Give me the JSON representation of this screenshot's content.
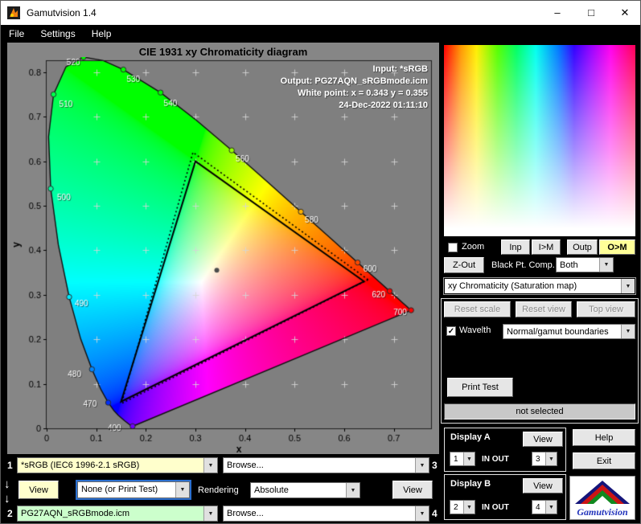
{
  "icons": {
    "combo_arrow": "▼",
    "check": "✓",
    "down_arrow": "↓",
    "minimize": "–",
    "maximize": "□",
    "close": "✕"
  },
  "window": {
    "title": "Gamutvision 1.4"
  },
  "menu": {
    "items": [
      "File",
      "Settings",
      "Help"
    ]
  },
  "chart": {
    "title": "CIE 1931 xy Chromaticity diagram",
    "annotations": {
      "input": "Input:  *sRGB",
      "output": "Output: PG27AQN_sRGBmode.icm",
      "white_point": "White point:  x = 0.343  y = 0.355",
      "datetime": "24-Dec-2022 01:11:10"
    }
  },
  "chart_data": {
    "type": "chromaticity-diagram",
    "title": "CIE 1931 xy Chromaticity diagram",
    "xlabel": "x",
    "ylabel": "y",
    "xlim": [
      0,
      0.775
    ],
    "ylim": [
      0,
      0.825
    ],
    "x_ticks": [
      0,
      0.1,
      0.2,
      0.3,
      0.4,
      0.5,
      0.6,
      0.7
    ],
    "y_ticks": [
      0,
      0.1,
      0.2,
      0.3,
      0.4,
      0.5,
      0.6,
      0.7,
      0.8
    ],
    "white_point": [
      0.343,
      0.355
    ],
    "srgb_triangle": [
      [
        0.64,
        0.33
      ],
      [
        0.3,
        0.6
      ],
      [
        0.15,
        0.06
      ]
    ],
    "output_triangle": [
      [
        0.648,
        0.334
      ],
      [
        0.295,
        0.62
      ],
      [
        0.151,
        0.056
      ]
    ],
    "spectral_locus": [
      [
        380,
        0.1741,
        0.005
      ],
      [
        390,
        0.1738,
        0.0049
      ],
      [
        400,
        0.1733,
        0.0048
      ],
      [
        410,
        0.1726,
        0.0048
      ],
      [
        420,
        0.1714,
        0.0051
      ],
      [
        430,
        0.1689,
        0.0069
      ],
      [
        440,
        0.1644,
        0.0109
      ],
      [
        450,
        0.1566,
        0.0177
      ],
      [
        460,
        0.144,
        0.0297
      ],
      [
        465,
        0.1355,
        0.0399
      ],
      [
        470,
        0.1241,
        0.0578
      ],
      [
        475,
        0.1096,
        0.0868
      ],
      [
        480,
        0.0913,
        0.1327
      ],
      [
        485,
        0.0687,
        0.2007
      ],
      [
        490,
        0.0454,
        0.295
      ],
      [
        495,
        0.0235,
        0.4127
      ],
      [
        500,
        0.0082,
        0.5384
      ],
      [
        505,
        0.0039,
        0.6548
      ],
      [
        510,
        0.0139,
        0.7502
      ],
      [
        515,
        0.0389,
        0.812
      ],
      [
        520,
        0.0743,
        0.8338
      ],
      [
        525,
        0.1142,
        0.8262
      ],
      [
        530,
        0.1547,
        0.8059
      ],
      [
        540,
        0.2296,
        0.7543
      ],
      [
        550,
        0.3016,
        0.6923
      ],
      [
        560,
        0.3731,
        0.6245
      ],
      [
        570,
        0.4441,
        0.5547
      ],
      [
        580,
        0.5125,
        0.4866
      ],
      [
        590,
        0.5752,
        0.4242
      ],
      [
        600,
        0.627,
        0.3725
      ],
      [
        610,
        0.6658,
        0.334
      ],
      [
        620,
        0.6915,
        0.3083
      ],
      [
        630,
        0.7079,
        0.292
      ],
      [
        640,
        0.719,
        0.2809
      ],
      [
        650,
        0.726,
        0.274
      ],
      [
        660,
        0.73,
        0.27
      ],
      [
        680,
        0.7334,
        0.2666
      ],
      [
        700,
        0.7347,
        0.2653
      ]
    ],
    "wavelength_labels": [
      {
        "wl": "400",
        "x": 0.1733,
        "y": 0.0048,
        "dx": -31,
        "dy": 3
      },
      {
        "wl": "470",
        "x": 0.1241,
        "y": 0.0578,
        "dx": -31,
        "dy": 2
      },
      {
        "wl": "480",
        "x": 0.0913,
        "y": 0.1327,
        "dx": -30,
        "dy": 7
      },
      {
        "wl": "490",
        "x": 0.0454,
        "y": 0.295,
        "dx": 7,
        "dy": 9
      },
      {
        "wl": "500",
        "x": 0.0082,
        "y": 0.5384,
        "dx": 8,
        "dy": 11
      },
      {
        "wl": "510",
        "x": 0.0139,
        "y": 0.7502,
        "dx": 7,
        "dy": 13
      },
      {
        "wl": "520",
        "x": 0.0743,
        "y": 0.8338,
        "dx": -21,
        "dy": 7
      },
      {
        "wl": "530",
        "x": 0.1547,
        "y": 0.8059,
        "dx": 4,
        "dy": 13
      },
      {
        "wl": "540",
        "x": 0.2296,
        "y": 0.7543,
        "dx": 4,
        "dy": 14
      },
      {
        "wl": "560",
        "x": 0.3731,
        "y": 0.6245,
        "dx": 5,
        "dy": 11
      },
      {
        "wl": "580",
        "x": 0.5125,
        "y": 0.4866,
        "dx": 5,
        "dy": 11
      },
      {
        "wl": "600",
        "x": 0.627,
        "y": 0.3725,
        "dx": 7,
        "dy": 9
      },
      {
        "wl": "620",
        "x": 0.6915,
        "y": 0.3083,
        "dx": -22,
        "dy": 5
      },
      {
        "wl": "700",
        "x": 0.7347,
        "y": 0.2653,
        "dx": -22,
        "dy": 3
      }
    ]
  },
  "right_panel": {
    "zoom_label": "Zoom",
    "btn_inp": "Inp",
    "btn_im": "I>M",
    "btn_outp": "Outp",
    "btn_om": "O>M",
    "btn_zout": "Z-Out",
    "black_pt_label": "Black Pt. Comp.",
    "black_pt_value": "Both",
    "view_mode": "xy Chromaticity (Saturation map)",
    "btn_reset_scale": "Reset scale",
    "btn_reset_view": "Reset view",
    "btn_top_view": "Top view",
    "wavelth_label": "Wavelth",
    "wavelth_value": "Normal/gamut boundaries",
    "btn_print_test": "Print Test",
    "status": "not selected",
    "display_a": {
      "title": "Display A",
      "view": "View",
      "in": "1",
      "inout": "IN OUT",
      "out": "3"
    },
    "display_b": {
      "title": "Display B",
      "view": "View",
      "in": "2",
      "inout": "IN OUT",
      "out": "4"
    },
    "btn_help": "Help",
    "btn_exit": "Exit",
    "logo_text": "Gamutvision"
  },
  "bottom": {
    "slot1": "1",
    "slot2": "2",
    "slot3": "3",
    "slot4": "4",
    "profile1": "*sRGB   (IEC6 1996-2.1 sRGB)",
    "profile2": "PG27AQN_sRGBmode.icm",
    "browse1": "Browse...",
    "browse2": "Browse...",
    "view_left": "View",
    "view_right": "View",
    "intent": "None (or Print Test)",
    "rendering_label": "Rendering",
    "rendering_value": "Absolute"
  }
}
